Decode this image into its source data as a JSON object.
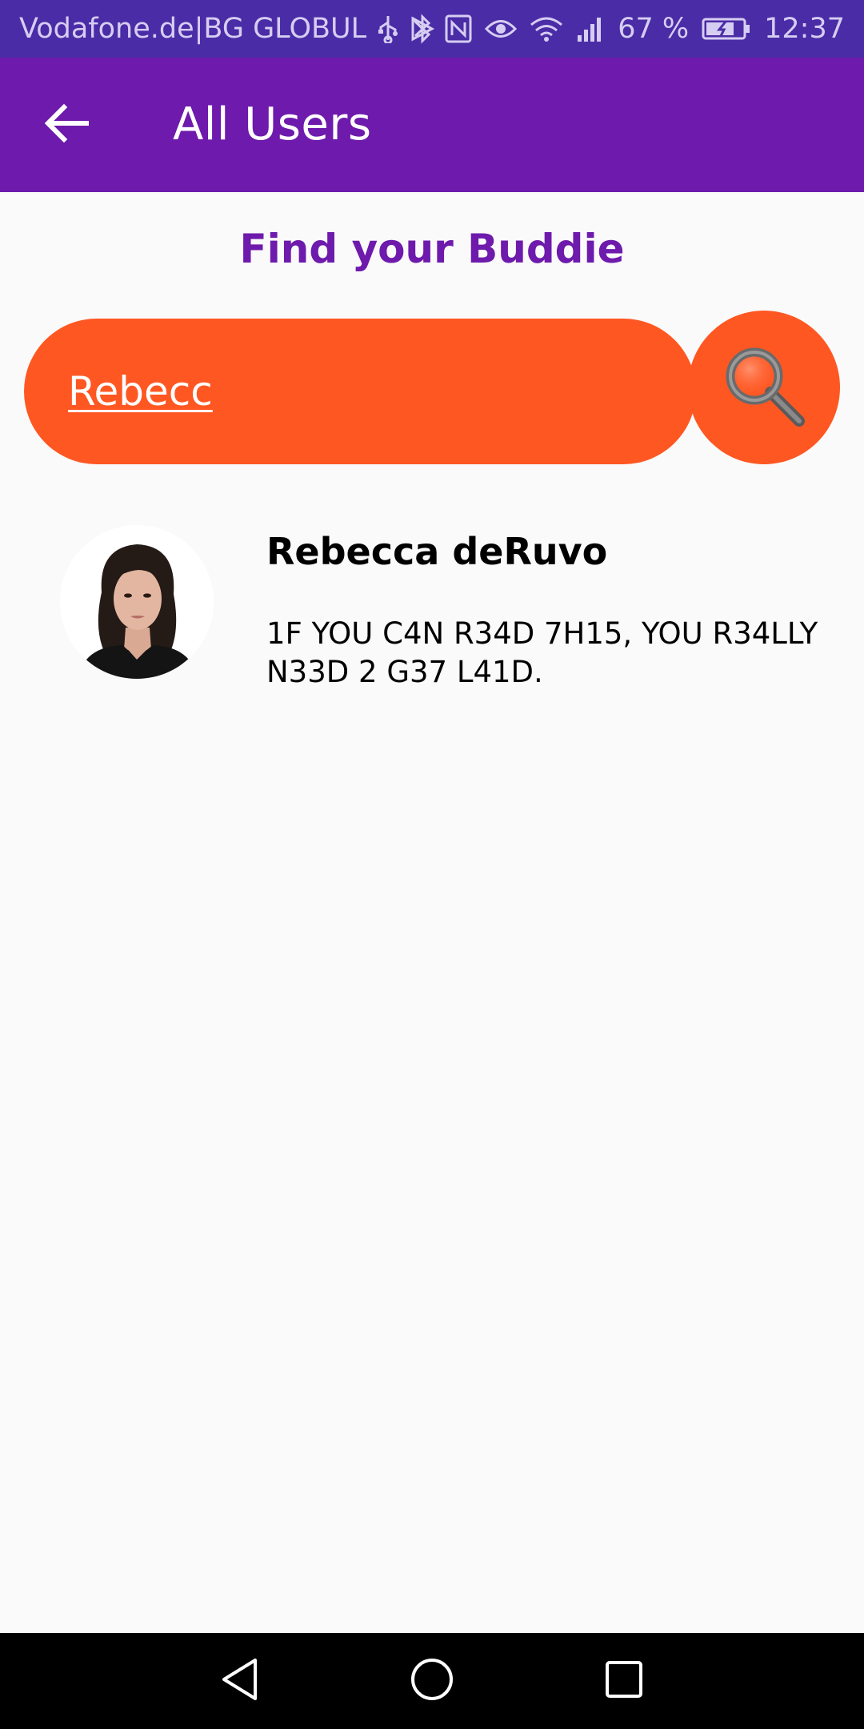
{
  "status_bar": {
    "carrier": "Vodafone.de|BG GLOBUL",
    "battery": "67 %",
    "time": "12:37"
  },
  "app_bar": {
    "title": "All Users"
  },
  "heading": "Find your Buddie",
  "search": {
    "value": "Rebecc"
  },
  "results": [
    {
      "name": "Rebecca deRuvo",
      "status": "1F YOU C4N R34D 7H15, YOU R34LLY N33D 2 G37 L41D."
    }
  ],
  "colors": {
    "status_bar": "#4a2ca6",
    "app_bar": "#6e1aac",
    "accent": "#ff5722",
    "heading": "#6e1aac"
  },
  "icons": {
    "back": "arrow-back-icon",
    "search": "magnifier-icon",
    "nav_back": "triangle-back-icon",
    "nav_home": "circle-home-icon",
    "nav_recents": "square-recents-icon"
  }
}
